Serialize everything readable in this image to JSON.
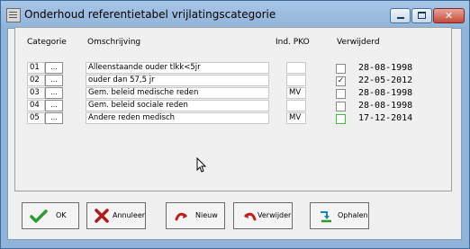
{
  "window": {
    "title": "Onderhoud referentietabel vrijlatingscategorie",
    "close_glyph": "✕"
  },
  "headers": {
    "category": "Categorie",
    "description": "Omschrijving",
    "ind_pko": "Ind. PKO",
    "deleted": "Verwijderd"
  },
  "rows": [
    {
      "code": "01",
      "button": "...",
      "description": "Alleenstaande ouder tlkk<5jr",
      "ind_pko": "",
      "deleted": false,
      "date": "28-08-1998"
    },
    {
      "code": "02",
      "button": "...",
      "description": "ouder dan 57,5 jr",
      "ind_pko": "",
      "deleted": true,
      "date": "22-05-2012"
    },
    {
      "code": "03",
      "button": "...",
      "description": "Gem. beleid medische reden",
      "ind_pko": "MV",
      "deleted": false,
      "date": "28-08-1998"
    },
    {
      "code": "04",
      "button": "...",
      "description": "Gem. beleid sociale reden",
      "ind_pko": "",
      "deleted": false,
      "date": "28-08-1998"
    },
    {
      "code": "05",
      "button": "...",
      "description": "Andere reden medisch",
      "ind_pko": "MV",
      "deleted": false,
      "date": "17-12-2014"
    }
  ],
  "buttons": {
    "ok": "OK",
    "cancel": "Annuleer",
    "new": "Nieuw",
    "delete": "Verwijder",
    "fetch": "Ophalen"
  },
  "icons": {
    "app": "table-icon",
    "ok": "checkmark-icon",
    "cancel": "cross-icon",
    "new": "curved-arrow-icon",
    "delete": "curved-arrow-back-icon",
    "fetch": "fetch-icon"
  }
}
